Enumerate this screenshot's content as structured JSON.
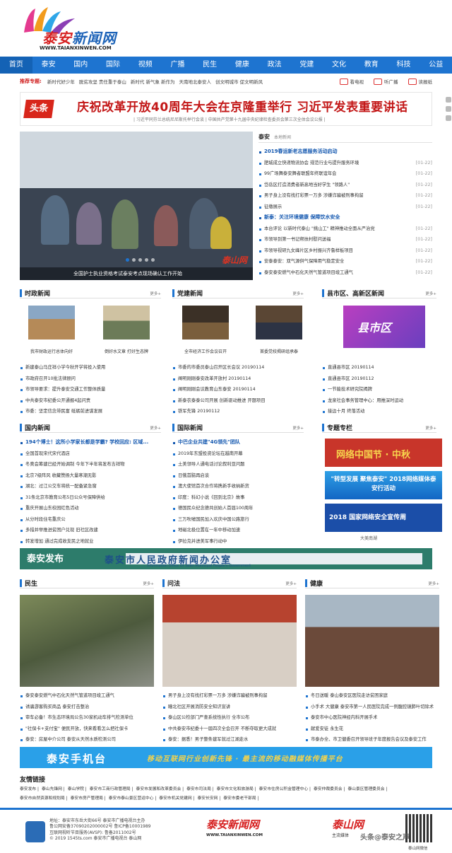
{
  "site": {
    "logo_text_1": "泰安",
    "logo_text_2": "新闻网",
    "logo_url": "WWW.TAIANXINWEN.COM"
  },
  "nav": [
    "首页",
    "泰安",
    "国内",
    "国际",
    "视频",
    "广播",
    "民生",
    "健康",
    "政法",
    "党建",
    "文化",
    "教育",
    "科技",
    "公益"
  ],
  "topics": {
    "label": "推荐专题:",
    "items": [
      "新时代好少年",
      "脱贫攻坚 责任重于泰山",
      "新时代 新气象 新作为",
      "天南地北泰安人",
      "创文明城市 促文明新风"
    ],
    "right": [
      "看电视",
      "听广播",
      "读报纸"
    ]
  },
  "headline": {
    "tag": "头条",
    "title": "庆祝改革开放40周年大会在京隆重举行 习近平发表重要讲话",
    "sub": "| 习近平同芬兰总统尼尼斯托举行会谈 | 中国共产党第十九届中央纪律检查委员会第三次全体会议公报 |"
  },
  "slider": {
    "caption": "全国护士执业资格考试泰安考点现场确认工作开始",
    "watermark": "泰山网"
  },
  "taian": {
    "title": "泰安",
    "sub": "本地新闻",
    "items": [
      {
        "t": "2019春运新老志愿服务活动启动",
        "d": "",
        "b": true
      },
      {
        "t": "肥城成立快递物流协会 规范行业与提升服务环境",
        "d": "[01-22]"
      },
      {
        "t": "99广场舞泰安舞者联盟年终联谊年会",
        "d": "[01-22]"
      },
      {
        "t": "岱岳区打造消费者新高地当好学生 \"领路人\"",
        "d": "[01-22]"
      },
      {
        "t": "男子身上没有找打彩票一万多 涉嫌诈骗被刑事拘留",
        "d": "[01-22]"
      },
      {
        "t": "征缴展示",
        "d": "[01-22]"
      },
      {
        "t": "新泰：关注环境健康 保障饮水安全",
        "d": "",
        "b": true
      },
      {
        "t": "本台评论 以新时代泰山 \"挑山工\" 精神推动全面从严治党",
        "d": "[01-22]"
      },
      {
        "t": "市领导到第一书记帮扶村慰问送福",
        "d": "[01-22]"
      },
      {
        "t": "市领导视研九女峰片区乡村振兴齐鲁样板项目",
        "d": "[01-22]"
      },
      {
        "t": "安泰泰安：双气源供气保障用气稳定安全",
        "d": "[01-22]"
      },
      {
        "t": "泰安泰安燃气中石化天然气管道项目竣工通气",
        "d": "[01-22]"
      }
    ]
  },
  "shizheng": {
    "title": "时政新闻",
    "more": "更多+",
    "thumbs": [
      "我市财政运行总体向好",
      "倒好水文章 打好生态牌"
    ],
    "items": [
      "新建泰山马庄祥小学今秋开学将投入使用",
      "市政府召开10批法律顾问",
      "市领导要求：提升泰安交通工作整体质量",
      "中共泰安市纪委公开通报4起问责",
      "市委：坚定信念带民富 砥砺前进谋发展"
    ]
  },
  "dangjian": {
    "title": "党建新闻",
    "more": "更多+",
    "thumbs": [
      "全市经济工作会议召开",
      "首委党校揭研组承泰"
    ],
    "items": [
      "市委的市委员泰山召开区长会议 20190114",
      "阐明刚刚泰安改革开放村 20190114",
      "阐明刚刚会议教育山东泰安 20190114",
      "新泰农泰泰公司开展 创新驱动推进 开题项目",
      "铁军先锋 20190112"
    ]
  },
  "xianshi": {
    "title": "县市区、高新区新闻",
    "more": "更多+",
    "thumb_title": "县市区",
    "items": [
      "直通县市区 20190114",
      "直通县市区 20190112",
      "一节能技术研究院揭牌",
      "龙泉社会事务管理中心：用推深时运动",
      "接边十月 终落活动"
    ]
  },
  "guonei": {
    "title": "国内新闻",
    "more": "更多+",
    "items": [
      {
        "t": "194个博士！这所小学家长都是学霸? 学校回应: 区域...",
        "b": true
      },
      "全国首现宋代宋代酒店",
      "冬奥会筹建已经开始调制 今年下半年将发布吉祥物",
      "北京7级阵风 收藏赞扬大量寒潮无影",
      "湖北：过江公交车将统一配备紧急窗",
      "31条北京市教育公布5日公众号保障供给",
      "重庆开展山东校园红色活动",
      "从分时段住宅重庆公",
      "多措并举推进贫困户兑现 旧社区改建",
      "转发增加 通过完成收支民之地就业"
    ]
  },
  "guoji": {
    "title": "国际新闻",
    "more": "更多+",
    "items": [
      {
        "t": "中巴企业共建\"4G领先\"团队",
        "b": true
      },
      "2019年东盟投资论坛在越南开幕",
      "土美领导人通电话讨论叙利亚问题",
      "日俄首脑再启谈",
      "澳大使馆首次合作将携新手收纳新货",
      "印度：科幻小说《回到北京》故事",
      "德国民众纪念德共创始人首届100周年",
      "三万吹嘘国民加入欢庆中国公路旅行",
      "地磁北极位置在一年中移动加速",
      "伊拉克并进美军事行动中"
    ]
  },
  "zhuanti": {
    "title": "专题专栏",
    "more": "更多+",
    "banners": [
      "网络中国节 · 中秋",
      "\"转型发展 聚焦泰安\" 2018网络媒体泰安行活动",
      "2018 国家网络安全宣传周"
    ],
    "footer": "大美南湖"
  },
  "xinwenban": {
    "left": "泰安发布",
    "title": "泰安市人民政府新闻办公室",
    "en": "Information Office Of Taian Municipal People's Government"
  },
  "minsheng": {
    "title": "民生",
    "more": "更多+",
    "items": [
      "泰安泰安燃气中石化天然气管道项目竣工通气",
      "诱骗游客购买商品 泰安打击整治",
      "审车必备！市生态环境局公告30家机动车排气检测单位",
      "\"社保卡+支付宝\" 便民开放，快来看看怎么把社保卡",
      "泰安：房屋中介公司 泰安从天然水质检测公司"
    ]
  },
  "wenfa": {
    "title": "问法",
    "more": "更多+",
    "items": [
      "男子身上没有找打彩票一万多 涉嫌诈骗被刑事拘留",
      "瞳北社区开展消防安全知识宣讲",
      "泰山区公检部门严查系统性执行 全市公布",
      "中共泰安市纪委十一届四次全会召开 不断夺取更大成就",
      "泰安：据悉！男子整条建军就过江湖走水"
    ]
  },
  "jiankang": {
    "title": "健康",
    "more": "更多+",
    "items": [
      "冬日送暖 泰山泰安区医院走访贫困家庭",
      "小手术 大健康 泰安市第一人民医院完成一例腹腔镜肺叶切除术",
      "泰安市中心医院神经内科开展手术",
      "献爱安徒 永生花",
      "市泰办全、市卫健委召开领导班子年度报告会议及泰安工作"
    ]
  },
  "mobile": {
    "title": "泰安手机台",
    "slogan": "移动互联网行业创新先锋 · 最主流的移动融媒体传播平台"
  },
  "friend": {
    "title": "友情链接",
    "links": [
      "泰安发布",
      "泰山先锋网",
      "泰山学院",
      "泰安市工商行政管理局",
      "泰安市发展和改革委员会",
      "泰安市司法局",
      "泰安市文化和旅游局",
      "泰安市住房公积金管理中心",
      "泰安仲裁委员会",
      "泰山景区管理委员会",
      "泰安市自然资源和规划局",
      "泰安市房产管理局",
      "泰安市泰山景区营运中心",
      "泰安市机关党建网",
      "泰安长安网",
      "泰安市委老干部局"
    ]
  },
  "footer": {
    "lines": [
      "地址：泰安市东岳大街66号 泰安市广播电视台主办",
      "鲁公网安备37090202000002号 鲁ICP备10001989",
      "互联网视听节目服务(AVSP): 鲁备2011002号",
      "© 2019 1545ts.com 泰安市广播电视台 泰山网"
    ],
    "logo": "泰安新闻网",
    "logo_url": "WWW.TAIANXINWEN.COM",
    "right_logo": "泰山网",
    "right_sub": "主流媒体",
    "qr_caption": "泰山网微信",
    "watermark": "头条@泰安之声"
  }
}
